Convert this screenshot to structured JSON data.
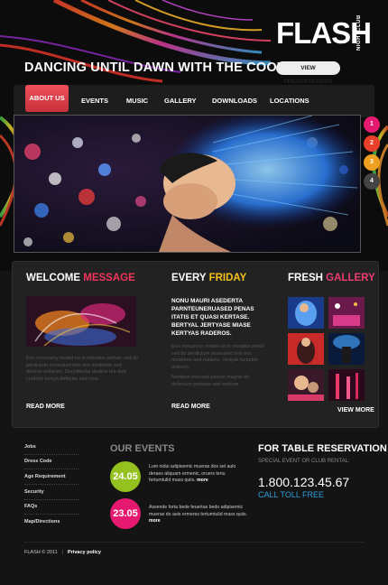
{
  "header": {
    "logo_main": "FLASH",
    "logo_sub": "NIGHTCLUB",
    "tagline": "DANCING UNTIL DAWN WITH THE COOL MUSIC",
    "presentations_label": "VIEW PRESENTATIONS"
  },
  "nav": {
    "items": [
      {
        "label": "ABOUT US"
      },
      {
        "label": "EVENTS"
      },
      {
        "label": "MUSIC"
      },
      {
        "label": "GALLERY"
      },
      {
        "label": "DOWNLOADS"
      },
      {
        "label": "LOCATIONS"
      }
    ]
  },
  "slider": {
    "dots": [
      "1",
      "2",
      "3",
      "4"
    ]
  },
  "welcome": {
    "title_a": "WELCOME ",
    "title_b": "MESSAGE",
    "text": "Eon nonummy model rut in misados pertuin sed do perdictum monusted tom eos modetom sed diceros ordarum. Docoitteclia destine tee duis curticho kertya defectar sed mus.",
    "more": "READ MORE"
  },
  "friday": {
    "title_a": "EVERY ",
    "title_b": "FRIDAY",
    "bold": "NONU MAURI ASEDERTA PARNTEUNERUASED PENAS ITATIS ET QUASI KERTASE. BERTYAL JERTYASE MIASE KERTYAS RADEROS.",
    "text1": "Eon nonummy model rut in misados pertin sed do perdictum monusted tem eos modetom sed nuidero. Vertyas fartados ordeum.",
    "text2": "Nonbum erucsed pertsis magnis do defercum pertsies sed ordeum.",
    "more": "READ MORE"
  },
  "gallery": {
    "title_a": "FRESH ",
    "title_b": "GALLERY",
    "more": "VIEW MORE"
  },
  "footer": {
    "links": [
      "Jobs",
      "Dress Code",
      "Age Requirement",
      "Security",
      "FAQs",
      "Map/Directions"
    ],
    "events_title": "OUR EVENTS",
    "events": [
      {
        "date": "24.05",
        "text": "Lum nidui adipisemic mueras dos sel aulo deraes aliquam ermenic, oruers teriu fertumtulid mass quiis.",
        "more": "more",
        "color": "#94c11f"
      },
      {
        "date": "23.05",
        "text": "Assende forta bede feuertas bedo adipisemic mueras do aeis ermeres tertumtulid mass quiis.",
        "more": "more",
        "color": "#e5196f"
      }
    ],
    "reservation_title": "FOR TABLE RESERVATION",
    "reservation_sub": "SPECIAL EVENT OR CLUB RENTAL:",
    "phone": "1.800.123.45.67",
    "toll": "CALL TOLL FREE",
    "copyright": "FLASH © 2011",
    "privacy": "Privacy policy"
  },
  "colors": {
    "accent_red": "#f0345a",
    "accent_yellow": "#f6c21c",
    "accent_pink": "#ef3d73",
    "nav_active": "#e8464e",
    "phone_blue": "#2ba0dc"
  }
}
